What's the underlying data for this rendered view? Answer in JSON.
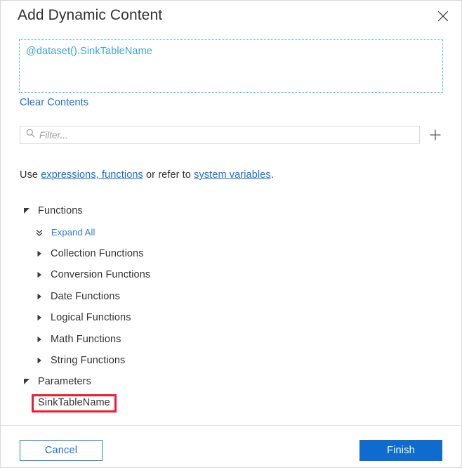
{
  "dialog": {
    "title": "Add Dynamic Content",
    "close_icon": "close-icon"
  },
  "expression": {
    "value": "@dataset().SinkTableName",
    "clear_label": "Clear Contents",
    "text_color": "#3aa3d6",
    "border_color": "#37b3e9"
  },
  "filter": {
    "placeholder": "Filter...",
    "value": "",
    "search_icon": "search-icon",
    "add_icon": "plus-icon"
  },
  "hint": {
    "prefix": "Use ",
    "link1": "expressions, functions",
    "middle": " or refer to ",
    "link2": "system variables",
    "suffix": "."
  },
  "tree": {
    "functions_group": {
      "label": "Functions",
      "expanded": true
    },
    "expand_all": {
      "label": "Expand All",
      "icon": "double-chevron-down-icon"
    },
    "function_categories": [
      {
        "label": "Collection Functions"
      },
      {
        "label": "Conversion Functions"
      },
      {
        "label": "Date Functions"
      },
      {
        "label": "Logical Functions"
      },
      {
        "label": "Math Functions"
      },
      {
        "label": "String Functions"
      }
    ],
    "parameters_group": {
      "label": "Parameters",
      "expanded": true
    },
    "parameters": [
      {
        "label": "SinkTableName",
        "highlighted": true
      }
    ]
  },
  "footer": {
    "cancel_label": "Cancel",
    "finish_label": "Finish",
    "primary_color": "#0f6cce"
  },
  "annotation": {
    "highlight_color": "#ed1c33"
  }
}
